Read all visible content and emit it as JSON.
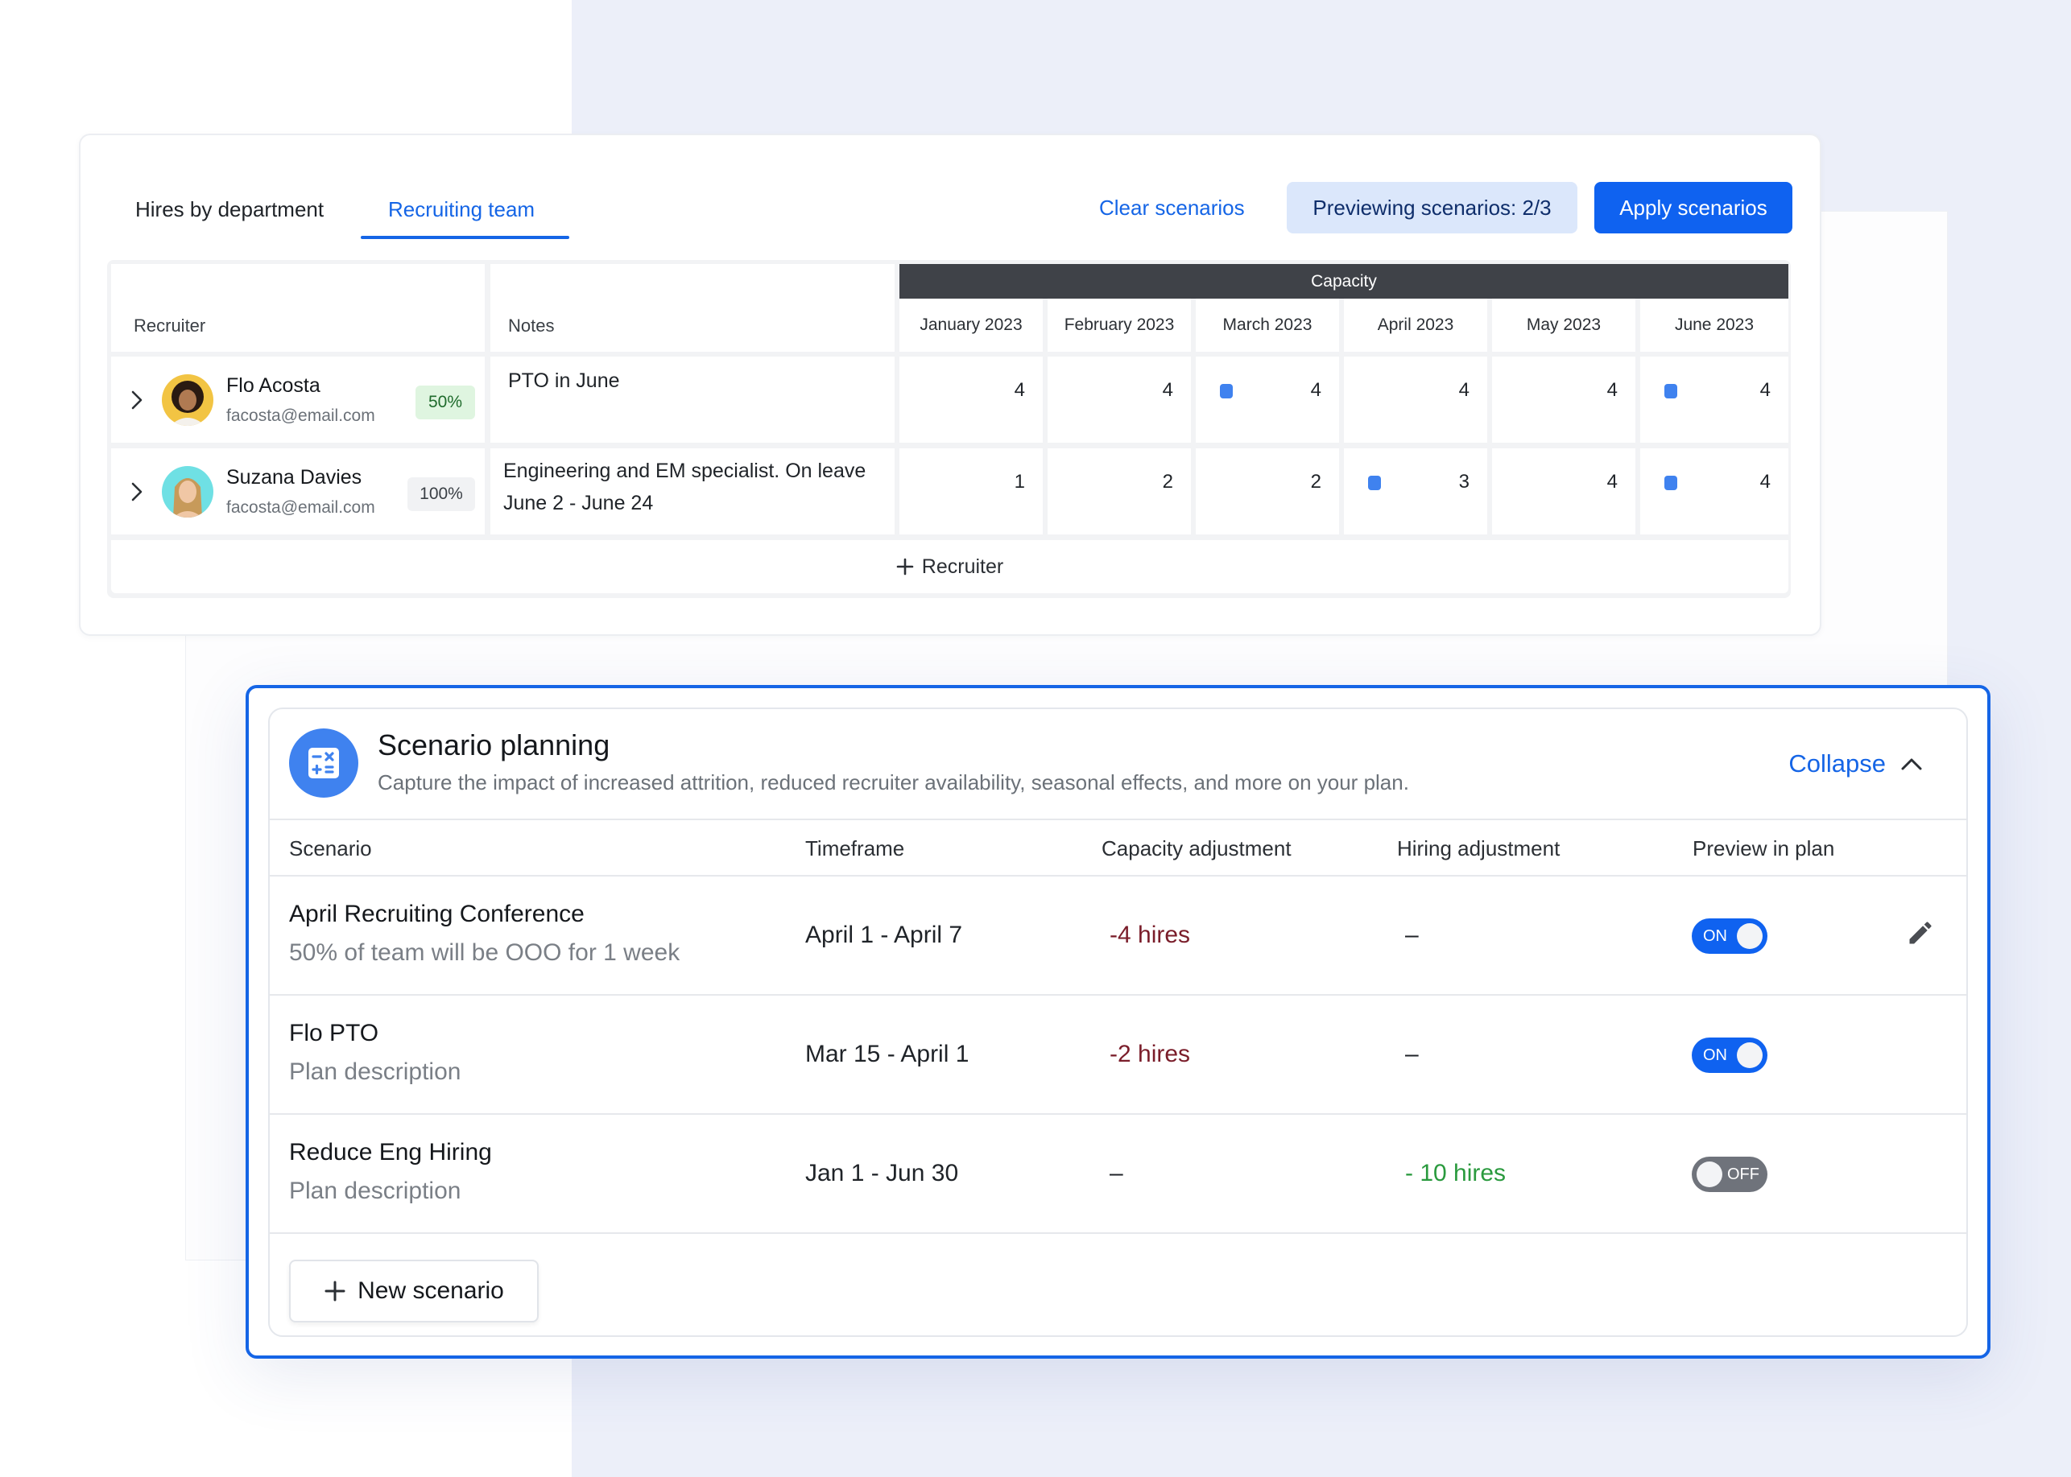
{
  "tabs": [
    {
      "label": "Hires by department",
      "active": false
    },
    {
      "label": "Recruiting team",
      "active": true
    }
  ],
  "toolbar": {
    "clear_label": "Clear scenarios",
    "preview_label": "Previewing scenarios: 2/3",
    "apply_label": "Apply scenarios"
  },
  "table": {
    "headers": {
      "recruiter": "Recruiter",
      "notes": "Notes",
      "capacity": "Capacity"
    },
    "months": [
      "January 2023",
      "February 2023",
      "March 2023",
      "April 2023",
      "May 2023",
      "June 2023"
    ],
    "rows": [
      {
        "name": "Flo Acosta",
        "email": "facosta@email.com",
        "allocation": "50%",
        "notes": "PTO in June",
        "notes_line2": "",
        "capacity": [
          "4",
          "4",
          "4",
          "4",
          "4",
          "4"
        ],
        "scenario_marker": [
          false,
          false,
          true,
          false,
          false,
          true
        ]
      },
      {
        "name": "Suzana Davies",
        "email": "facosta@email.com",
        "allocation": "100%",
        "notes": "Engineering and EM specialist. On leave",
        "notes_line2": "June 2 - June 24",
        "capacity": [
          "1",
          "2",
          "2",
          "3",
          "4",
          "4"
        ],
        "scenario_marker": [
          false,
          false,
          false,
          true,
          false,
          true
        ]
      }
    ],
    "add_label": "Recruiter"
  },
  "scenario_planning": {
    "icon": "calculator-icon",
    "title": "Scenario planning",
    "subtitle": "Capture the impact of increased attrition, reduced recruiter availability, seasonal effects, and more on your plan.",
    "collapse_label": "Collapse",
    "columns": [
      "Scenario",
      "Timeframe",
      "Capacity adjustment",
      "Hiring adjustment",
      "Preview in plan"
    ],
    "scenarios": [
      {
        "name": "April Recruiting Conference",
        "description": "50% of team will be OOO for 1 week",
        "timeframe": "April 1 - April 7",
        "capacity_adjustment": "-4 hires",
        "hiring_adjustment": "–",
        "preview": "ON"
      },
      {
        "name": "Flo PTO",
        "description": "Plan description",
        "timeframe": "Mar 15 - April 1",
        "capacity_adjustment": "-2 hires",
        "hiring_adjustment": "–",
        "preview": "ON"
      },
      {
        "name": "Reduce Eng Hiring",
        "description": "Plan description",
        "timeframe": "Jan 1 - Jun 30",
        "capacity_adjustment": "–",
        "hiring_adjustment": "- 10 hires",
        "preview": "OFF"
      }
    ],
    "new_label": "New scenario"
  },
  "colors": {
    "accent": "#1565e6",
    "apply_button": "#0f62f0",
    "preview_badge": "#dbe7fb",
    "capacity_header": "#3f4248",
    "negative": "#7a1d2a",
    "positive": "#2a9a3e",
    "marker": "#3f82ef"
  }
}
